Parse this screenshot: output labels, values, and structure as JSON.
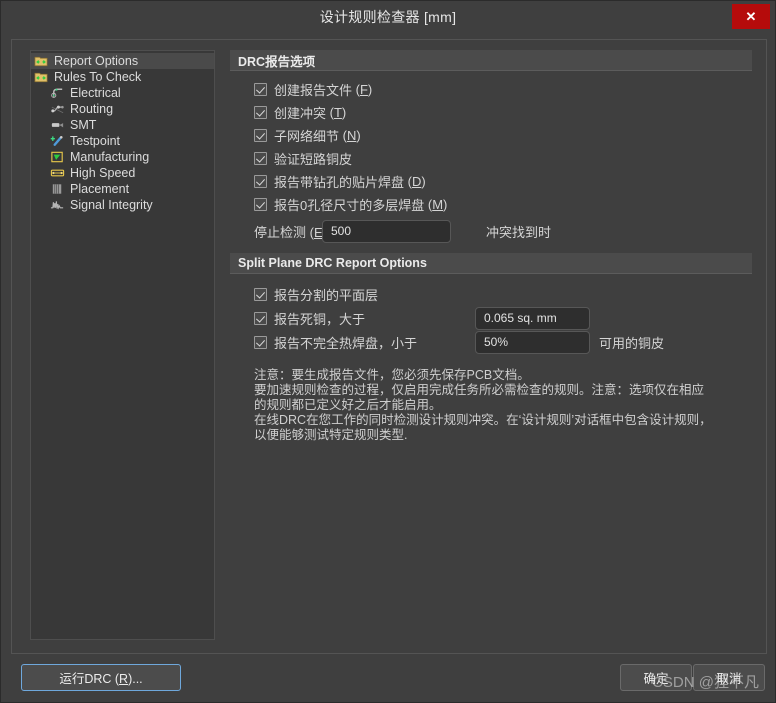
{
  "window": {
    "title": "设计规则检查器 [mm]",
    "close_label": "✕",
    "accent_close": "#b50b0b",
    "accent_focus": "#6fa8dc"
  },
  "sidebar": {
    "items": [
      {
        "label": "Report Options",
        "icon": "folder-arrows-icon",
        "level": 0,
        "selected": true
      },
      {
        "label": "Rules To Check",
        "icon": "folder-arrows-icon",
        "level": 0,
        "selected": false
      },
      {
        "label": "Electrical",
        "icon": "electrical-icon",
        "level": 1,
        "selected": false
      },
      {
        "label": "Routing",
        "icon": "routing-icon",
        "level": 1,
        "selected": false
      },
      {
        "label": "SMT",
        "icon": "smt-icon",
        "level": 1,
        "selected": false
      },
      {
        "label": "Testpoint",
        "icon": "testpoint-icon",
        "level": 1,
        "selected": false
      },
      {
        "label": "Manufacturing",
        "icon": "manufacturing-icon",
        "level": 1,
        "selected": false
      },
      {
        "label": "High Speed",
        "icon": "high-speed-icon",
        "level": 1,
        "selected": false
      },
      {
        "label": "Placement",
        "icon": "placement-icon",
        "level": 1,
        "selected": false
      },
      {
        "label": "Signal Integrity",
        "icon": "signal-integrity-icon",
        "level": 1,
        "selected": false
      }
    ]
  },
  "drc_report": {
    "header": "DRC报告选项",
    "options": [
      {
        "label": "创建报告文件",
        "accel": "F",
        "checked": true
      },
      {
        "label": "创建冲突",
        "accel": "T",
        "checked": true
      },
      {
        "label": "子网络细节",
        "accel": "N",
        "checked": true
      },
      {
        "label": "验证短路铜皮",
        "accel": "",
        "checked": true
      },
      {
        "label": "报告带钻孔的贴片焊盘",
        "accel": "D",
        "checked": true
      },
      {
        "label": "报告0孔径尺寸的多层焊盘",
        "accel": "M",
        "checked": true
      }
    ],
    "stop_row": {
      "label_prefix": "停止检测 (",
      "accel": "E",
      "label_suffix": ")",
      "value": "500",
      "suffix_text": "冲突找到时"
    }
  },
  "split_plane": {
    "header": "Split Plane DRC Report Options",
    "rows": [
      {
        "label": "报告分割的平面层",
        "checked": true,
        "value": "",
        "suffix": ""
      },
      {
        "label": "报告死铜，大于",
        "checked": true,
        "value": "0.065 sq. mm",
        "suffix": ""
      },
      {
        "label": "报告不完全热焊盘，小于",
        "checked": true,
        "value": "50%",
        "suffix": "可用的铜皮"
      }
    ]
  },
  "note": {
    "line1": "注意：要生成报告文件，您必须先保存PCB文档。",
    "line2": "要加速规则检查的过程，仅启用完成任务所必需检查的规则。注意：选项仅在相应",
    "line3": "的规则都已定义好之后才能启用。",
    "line4": "在线DRC在您工作的同时检测设计规则冲突。在‘设计规则’对话框中包含设计规则，",
    "line5": "以便能够测试特定规则类型."
  },
  "footer": {
    "run_drc_prefix": "运行DRC (",
    "run_drc_accel": "R",
    "run_drc_suffix": ")...",
    "ok_label": "确定",
    "cancel_label": "取消",
    "watermark": "CSDN @狸不凡"
  }
}
